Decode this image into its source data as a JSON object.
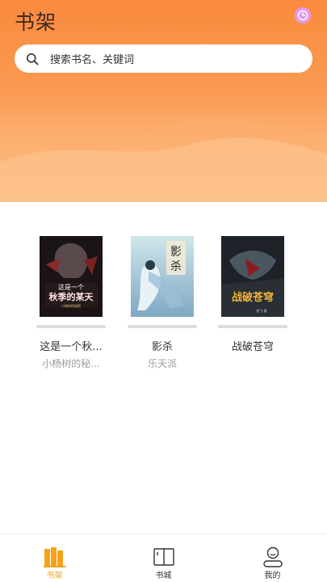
{
  "header": {
    "title": "书架",
    "history_icon": "clock-icon",
    "gradient_top": "#f98a3d",
    "gradient_bottom": "#fdd0a3"
  },
  "search": {
    "placeholder": "搜索书名、关键词",
    "icon": "search-icon"
  },
  "books": [
    {
      "title": "这是一个秋...",
      "author": "小杨树的秘...",
      "cover_text": "这是一个秋季的某天"
    },
    {
      "title": "影杀",
      "author": "乐天派",
      "cover_text": "影杀"
    },
    {
      "title": "战破苍穹",
      "author": "",
      "cover_text": "战破苍穹"
    }
  ],
  "tabbar": {
    "active_color": "#f7a21b",
    "items": [
      {
        "label": "书架",
        "icon": "bookshelf-icon",
        "active": true
      },
      {
        "label": "书城",
        "icon": "book-open-icon",
        "active": false
      },
      {
        "label": "我的",
        "icon": "user-icon",
        "active": false
      }
    ]
  }
}
